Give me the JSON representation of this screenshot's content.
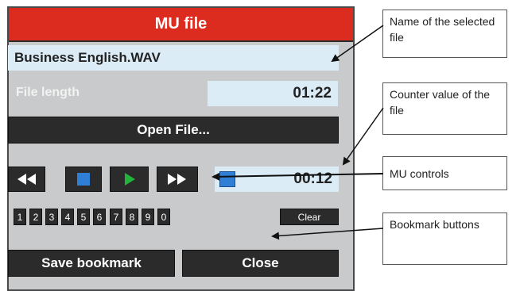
{
  "window": {
    "title": "MU file"
  },
  "file": {
    "name": "Business English.WAV",
    "length_label": "File length",
    "length_value": "01:22",
    "open_button": "Open File..."
  },
  "controls": {
    "rewind_icon": "rewind-icon",
    "stop_icon": "stop-icon",
    "play_icon": "play-icon",
    "fastforward_icon": "fast-forward-icon",
    "counter_value": "00:12"
  },
  "bookmarks": {
    "numbers": [
      "1",
      "2",
      "3",
      "4",
      "5",
      "6",
      "7",
      "8",
      "9",
      "0"
    ],
    "clear_label": "Clear",
    "save_label": "Save bookmark",
    "close_label": "Close"
  },
  "callouts": {
    "name": "Name of the selected file",
    "counter": "Counter value of the file",
    "controls": "MU controls",
    "bookmarks": "Bookmark buttons"
  },
  "colors": {
    "title_bar": "#dc2b1f",
    "panel": "#c9cacb",
    "field": "#dcecf6",
    "button": "#2b2b2b",
    "stop": "#2f7fd6",
    "play": "#22b43a"
  }
}
